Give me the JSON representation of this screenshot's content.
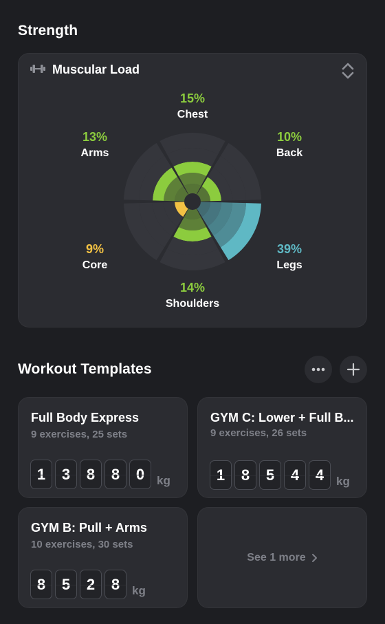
{
  "strength": {
    "title": "Strength",
    "card_title": "Muscular Load",
    "muscles": [
      {
        "name": "Chest",
        "pct": "15%",
        "color": "#8ccc3e"
      },
      {
        "name": "Back",
        "pct": "10%",
        "color": "#8ccc3e"
      },
      {
        "name": "Legs",
        "pct": "39%",
        "color": "#5fb8c4"
      },
      {
        "name": "Shoulders",
        "pct": "14%",
        "color": "#8ccc3e"
      },
      {
        "name": "Core",
        "pct": "9%",
        "color": "#f3c244"
      },
      {
        "name": "Arms",
        "pct": "13%",
        "color": "#8ccc3e"
      }
    ]
  },
  "templates": {
    "title": "Workout Templates",
    "cards": [
      {
        "title": "Full Body Express",
        "subtitle": "9 exercises, 25 sets",
        "digits": [
          "1",
          "3",
          "8",
          "8",
          "0"
        ],
        "unit": "kg"
      },
      {
        "title": "GYM C: Lower + Full B...",
        "subtitle": "9 exercises, 26 sets",
        "digits": [
          "1",
          "8",
          "5",
          "4",
          "4"
        ],
        "unit": "kg"
      },
      {
        "title": "GYM B: Pull + Arms",
        "subtitle": "10 exercises, 30 sets",
        "digits": [
          "8",
          "5",
          "2",
          "8"
        ],
        "unit": "kg"
      }
    ],
    "see_more": "See 1 more"
  },
  "icons": {
    "load": "dumbbell-icon",
    "sort": "sort-icon",
    "more": "ellipsis-icon",
    "add": "plus-icon",
    "chevron": "chevron-right-icon"
  }
}
